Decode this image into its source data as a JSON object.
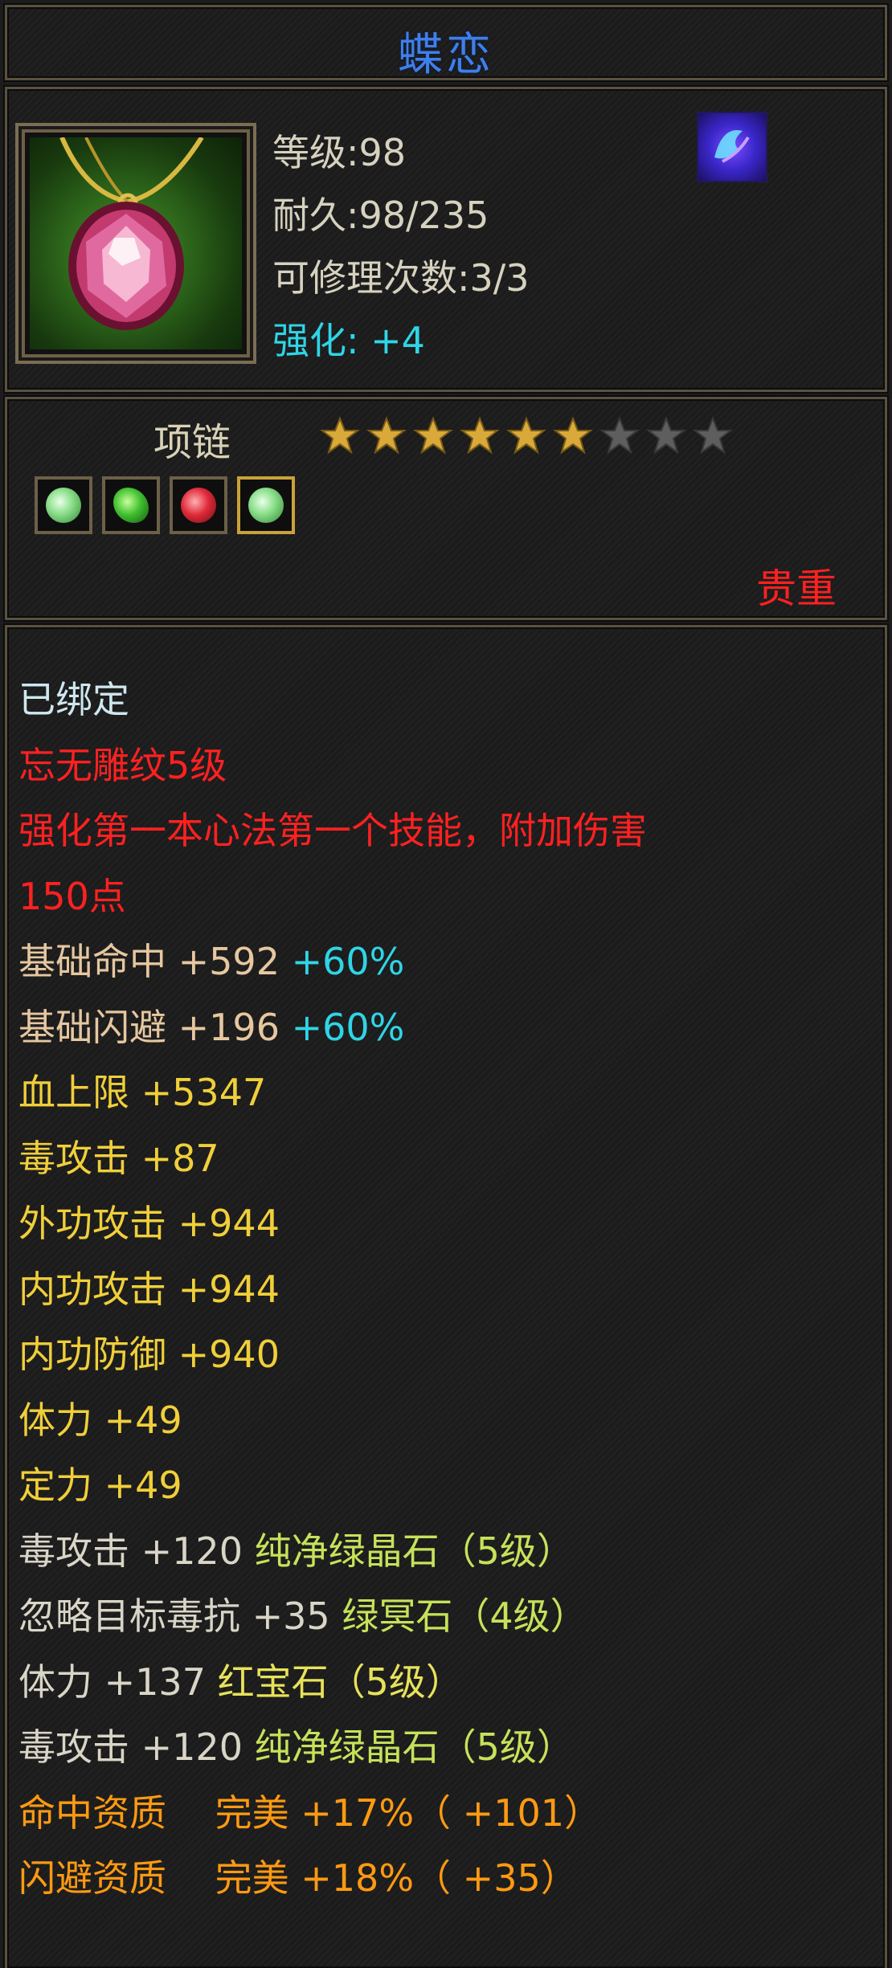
{
  "title": "蝶恋",
  "info": {
    "level": "等级:98",
    "durability": "耐久:98/235",
    "repair": "可修理次数:3/3",
    "enhance": "强化: +4"
  },
  "item_type": "项链",
  "stars": {
    "filled": 6,
    "total": 9
  },
  "gems": [
    "green-gem",
    "green-gem",
    "red-gem",
    "green-gem"
  ],
  "rarity": "贵重",
  "attributes": {
    "bound": "已绑定",
    "engrave": "忘无雕纹5级",
    "skill_line1": "强化第一本心法第一个技能，附加伤害",
    "skill_line2": "150点",
    "hit_base": "基础命中 +592",
    "hit_pct": "+60%",
    "dodge_base": "基础闪避 +196",
    "dodge_pct": "+60%",
    "hp": "血上限 +5347",
    "poison_atk": "毒攻击 +87",
    "ext_atk": "外功攻击 +944",
    "int_atk": "内功攻击 +944",
    "int_def": "内功防御 +940",
    "stamina": "体力 +49",
    "focus": "定力 +49",
    "gem1_stat": "毒攻击 +120",
    "gem1_name": "纯净绿晶石（5级）",
    "gem2_stat": "忽略目标毒抗 +35",
    "gem2_name": "绿冥石（4级）",
    "gem3_stat": "体力 +137",
    "gem3_name": "红宝石（5级）",
    "gem4_stat": "毒攻击 +120",
    "gem4_name": "纯净绿晶石（5级）",
    "q1": "命中资质　 完美 +17%（ +101）",
    "q2": "闪避资质　 完美 +18%（ +35）"
  },
  "colors": {
    "title": "#3f7fe8",
    "rarity": "#ff2020",
    "special": "#ff2121",
    "stat": "#f0cf3a",
    "bonus_pct": "#2fd5e6",
    "quality": "#ff9a12"
  }
}
